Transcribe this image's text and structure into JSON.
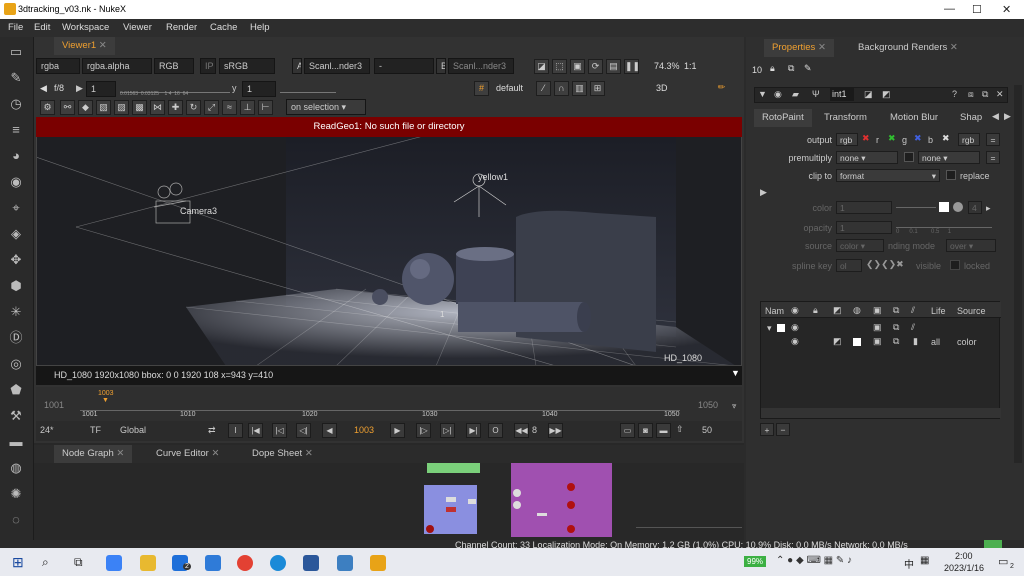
{
  "window": {
    "title": "3dtracking_v03.nk - NukeX"
  },
  "menu": [
    "File",
    "Edit",
    "Workspace",
    "Viewer",
    "Render",
    "Cache",
    "Help"
  ],
  "viewer": {
    "tab": "Viewer1",
    "row1": {
      "channels": "rgba",
      "alpha": "rgba.alpha",
      "colorspace": "RGB",
      "lut": "sRGB",
      "a_label": "A",
      "a_input": "Scanl...nder3",
      "a_op": "-",
      "b_label": "B",
      "b_input": "Scanl...nder3",
      "zoom": "74.3%",
      "ratio": "1:1"
    },
    "row2": {
      "fstop": "f/8",
      "frame": "1",
      "y_label": "y",
      "y_value": "1",
      "gain_ticks": [
        "0.01563",
        "0.03125",
        "1",
        "4",
        "16",
        "64"
      ],
      "default": "default",
      "mode": "3D"
    },
    "row3": {
      "selection": "on selection"
    },
    "error": "ReadGeo1: No such file or directory",
    "labels": {
      "camera": "Camera3",
      "light": "yellow1",
      "format": "HD_1080",
      "marker": "1"
    },
    "info": "HD_1080 1920x1080  bbox: 0 0 1920 108  x=943 y=410"
  },
  "timeline": {
    "start": "1001",
    "end": "1050",
    "current": "1003",
    "ticks": [
      "1001",
      "1010",
      "1020",
      "1030",
      "1040",
      "1050"
    ]
  },
  "playback": {
    "fps": "24*",
    "tf": "TF",
    "global": "Global",
    "frame": "1003",
    "step": "8",
    "end": "50",
    "i_label": "I",
    "o_label": "O"
  },
  "nodegraph": {
    "tabs": [
      "Node Graph",
      "Curve Editor",
      "Dope Sheet"
    ]
  },
  "properties": {
    "tabs": [
      "Properties",
      "Background Renders"
    ],
    "max_panels": "10",
    "node_name": "int1",
    "node_tabs": [
      "RotoPaint",
      "Transform",
      "Motion Blur",
      "Shap"
    ],
    "output_label": "output",
    "output_value": "rgb",
    "channels": [
      "r",
      "g",
      "b"
    ],
    "output_right": "rgb",
    "premult_label": "premultiply",
    "premult_value": "none",
    "premult_right": "none",
    "clip_label": "clip to",
    "clip_value": "format",
    "replace": "replace",
    "color_label": "color",
    "color_value": "1",
    "color_num": "4",
    "opacity_label": "opacity",
    "opacity_value": "1",
    "ramp_ticks": [
      "0",
      "0.1",
      "0.5",
      "1"
    ],
    "source_label": "source",
    "source_value": "color",
    "blend_label": "nding mode",
    "blend_value": "over",
    "spline_label": "spline key",
    "spline_value": "ol",
    "visible": "visible",
    "locked": "locked",
    "table_headers": [
      "Nam",
      "Life",
      "Source"
    ],
    "row_life": "all",
    "row_source": "color"
  },
  "status": "Channel Count: 33  Localization Mode: On  Memory: 1.2 GB (1.0%)  CPU: 10.9%  Disk: 0.0 MB/s  Network: 0.0 MB/s",
  "taskbar": {
    "time": "2:00",
    "date": "2023/1/16",
    "battery": "99%",
    "ime": "中",
    "notif": "2",
    "badge": "2"
  }
}
